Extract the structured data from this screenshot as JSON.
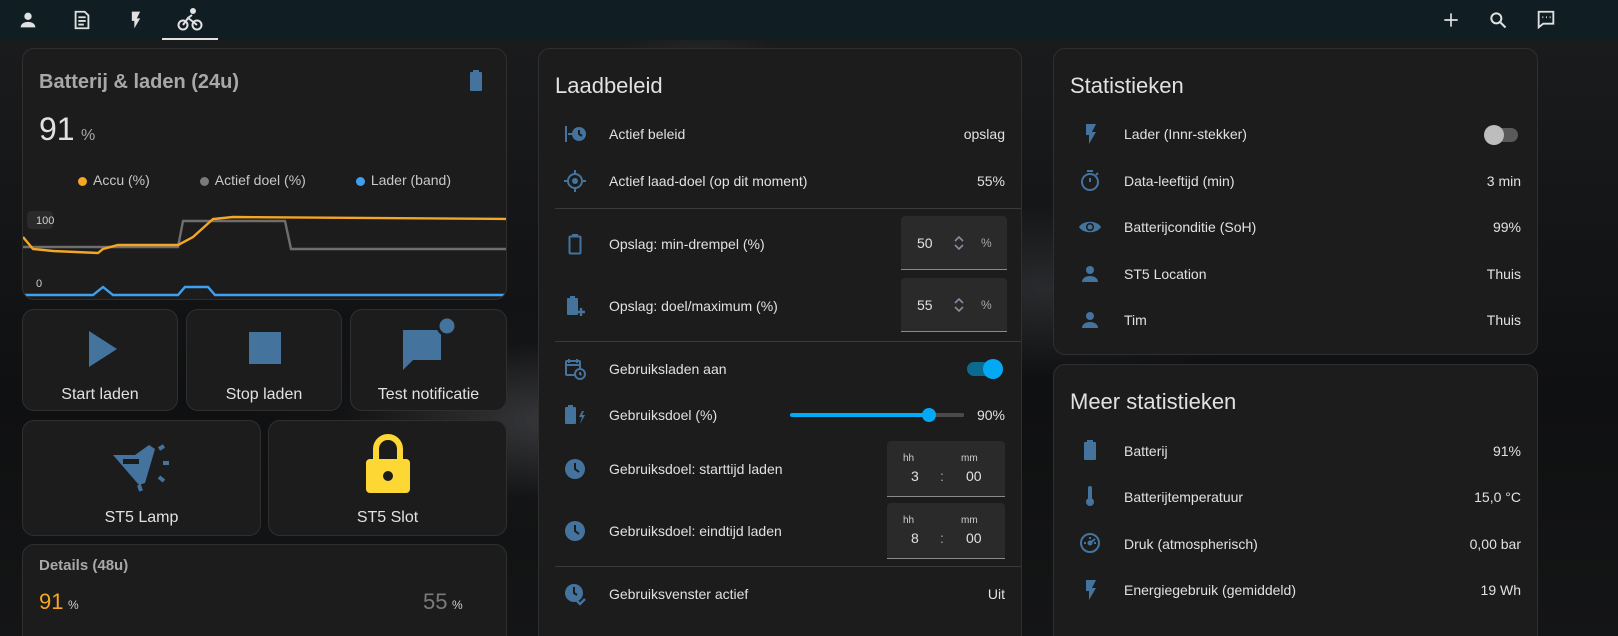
{
  "topbar": {
    "tabs": [
      {
        "icon": "account-icon"
      },
      {
        "icon": "list-icon"
      },
      {
        "icon": "flash-icon"
      },
      {
        "icon": "bike-icon",
        "active": true
      }
    ],
    "actions": [
      {
        "icon": "plus-icon"
      },
      {
        "icon": "search-icon"
      },
      {
        "icon": "assist-icon"
      }
    ]
  },
  "battery_card": {
    "title": "Batterij & laden (24u)",
    "value": "91",
    "unit": "%",
    "legend": [
      {
        "label": "Accu (%)",
        "color": "#f5a623"
      },
      {
        "label": "Actief doel (%)",
        "color": "#7a7a7a"
      },
      {
        "label": "Lader (band)",
        "color": "#3ea0f0"
      }
    ],
    "axis_top": "100",
    "axis_bottom": "0"
  },
  "buttons": [
    {
      "label": "Start laden",
      "icon": "play-icon"
    },
    {
      "label": "Stop laden",
      "icon": "stop-icon"
    },
    {
      "label": "Test notificatie",
      "icon": "message-badge-icon"
    }
  ],
  "buttons2": [
    {
      "label": "ST5 Lamp",
      "icon": "lamp-icon"
    },
    {
      "label": "ST5 Slot",
      "icon": "lock-icon"
    }
  ],
  "details_card": {
    "title": "Details (48u)",
    "value1": "91",
    "unit1": "%",
    "value2": "55",
    "unit2": "%"
  },
  "laadbeleid": {
    "title": "Laadbeleid",
    "actief_beleid": {
      "label": "Actief beleid",
      "value": "opslag"
    },
    "actief_doel": {
      "label": "Actief laad-doel (op dit moment)",
      "value": "55%"
    },
    "opslag_min": {
      "label": "Opslag: min-drempel (%)",
      "value": "50",
      "unit": "%"
    },
    "opslag_doel": {
      "label": "Opslag: doel/maximum (%)",
      "value": "55",
      "unit": "%"
    },
    "gebruiksladen": {
      "label": "Gebruiksladen aan",
      "on": true
    },
    "gebruiksdoel": {
      "label": "Gebruiksdoel (%)",
      "value": "90%",
      "level": 0.9
    },
    "starttijd": {
      "label": "Gebruiksdoel: starttijd laden",
      "hh_label": "hh",
      "mm_label": "mm",
      "hh": "3",
      "mm": "00",
      "sep": ":"
    },
    "eindtijd": {
      "label": "Gebruiksdoel: eindtijd laden",
      "hh_label": "hh",
      "mm_label": "mm",
      "hh": "8",
      "mm": "00",
      "sep": ":"
    },
    "venster": {
      "label": "Gebruiksvenster actief",
      "value": "Uit"
    }
  },
  "statistieken": {
    "title": "Statistieken",
    "rows": [
      {
        "label": "Lader (Innr-stekker)",
        "value": "",
        "icon": "flash-icon"
      },
      {
        "label": "Data-leeftijd (min)",
        "value": "3 min",
        "icon": "timer-icon"
      },
      {
        "label": "Batterijconditie (SoH)",
        "value": "99%",
        "icon": "eye-icon"
      },
      {
        "label": "ST5 Location",
        "value": "Thuis",
        "icon": "account-icon"
      },
      {
        "label": "Tim",
        "value": "Thuis",
        "icon": "account-icon"
      }
    ]
  },
  "meer_statistieken": {
    "title": "Meer statistieken",
    "rows": [
      {
        "label": "Batterij",
        "value": "91%",
        "icon": "battery-icon"
      },
      {
        "label": "Batterijtemperatuur",
        "value": "15,0 °C",
        "icon": "thermometer-icon"
      },
      {
        "label": "Druk (atmospherisch)",
        "value": "0,00 bar",
        "icon": "gauge-icon"
      },
      {
        "label": "Energiegebruik (gemiddeld)",
        "value": "19 Wh",
        "icon": "flash-icon"
      }
    ]
  },
  "colors": {
    "accent": "#03a9f4",
    "icon": "#44739e",
    "yellow": "#fdd835",
    "orange": "#f5a623"
  }
}
